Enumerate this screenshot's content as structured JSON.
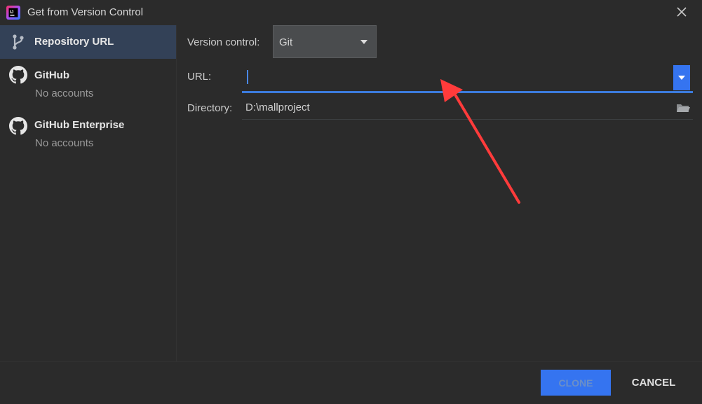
{
  "window": {
    "title": "Get from Version Control",
    "app_icon": "intellij-idea-icon",
    "close_icon": "close-icon"
  },
  "sidebar": {
    "items": [
      {
        "label": "Repository URL",
        "sub": "",
        "icon": "vcs-branch-icon",
        "selected": true
      },
      {
        "label": "GitHub",
        "sub": "No accounts",
        "icon": "github-icon",
        "selected": false
      },
      {
        "label": "GitHub Enterprise",
        "sub": "No accounts",
        "icon": "github-icon",
        "selected": false
      }
    ]
  },
  "form": {
    "version_control_label": "Version control:",
    "version_control_value": "Git",
    "url_label": "URL:",
    "url_value": "",
    "directory_label": "Directory:",
    "directory_value": "D:\\mallproject"
  },
  "footer": {
    "clone_label": "CLONE",
    "cancel_label": "CANCEL"
  },
  "colors": {
    "accent": "#3574f0",
    "selection": "#334157",
    "background": "#2b2b2b",
    "annotation_arrow": "#ff3b3b"
  }
}
